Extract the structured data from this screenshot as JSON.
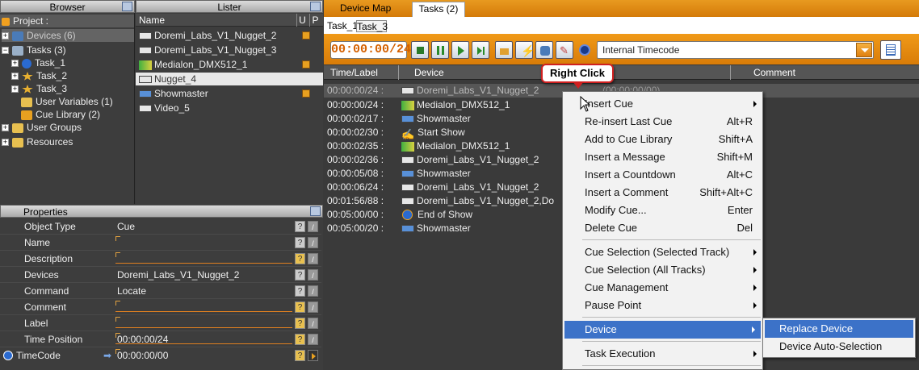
{
  "browser": {
    "header": "Browser",
    "tree": [
      {
        "label": "Project :"
      },
      {
        "label": "Devices (6)"
      },
      {
        "label": "Tasks (3)"
      },
      {
        "label": "Task_1"
      },
      {
        "label": "Task_2"
      },
      {
        "label": "Task_3"
      },
      {
        "label": "User Variables (1)"
      },
      {
        "label": "Cue Library (2)"
      },
      {
        "label": "User Groups"
      },
      {
        "label": "Resources"
      }
    ]
  },
  "lister": {
    "header": "Lister",
    "col_name": "Name",
    "col_u": "U",
    "col_p": "P",
    "items": [
      {
        "label": "Doremi_Labs_V1_Nugget_2"
      },
      {
        "label": "Doremi_Labs_V1_Nugget_3"
      },
      {
        "label": "Medialon_DMX512_1"
      },
      {
        "label": "Nugget_4"
      },
      {
        "label": "Showmaster"
      },
      {
        "label": "Video_5"
      }
    ]
  },
  "properties": {
    "header": "Properties",
    "rows": [
      {
        "label": "Object Type",
        "value": "Cue"
      },
      {
        "label": "Name",
        "value": ""
      },
      {
        "label": "Description",
        "value": ""
      },
      {
        "label": "Devices",
        "value": "Doremi_Labs_V1_Nugget_2"
      },
      {
        "label": "Command",
        "value": "Locate"
      },
      {
        "label": "Comment",
        "value": ""
      },
      {
        "label": "Label",
        "value": ""
      },
      {
        "label": "Time Position",
        "value": "00:00:00/24"
      },
      {
        "label": "TimeCode",
        "value": "00:00:00/00"
      }
    ]
  },
  "devicemap": {
    "tab_device_map": "Device Map",
    "tab_tasks": "Tasks (2)",
    "subtab_1": "Task_1",
    "subtab_3": "Task_3",
    "timecode": "00:00:00/24",
    "timecode_source": "Internal Timecode",
    "col_time": "Time/Label",
    "col_device": "Device",
    "col_comment": "Comment",
    "cues": [
      {
        "time": "00:00:00/24 :",
        "device": "Doremi_Labs_V1_Nugget_2"
      },
      {
        "time": "00:00:00/24 :",
        "device": "Medialon_DMX512_1"
      },
      {
        "time": "00:00:02/17 :",
        "device": "Showmaster"
      },
      {
        "time": "00:00:02/30 :",
        "device": "Start Show"
      },
      {
        "time": "00:00:02/35 :",
        "device": "Medialon_DMX512_1"
      },
      {
        "time": "00:00:02/36 :",
        "device": "Doremi_Labs_V1_Nugget_2"
      },
      {
        "time": "00:00:05/08 :",
        "device": "Showmaster"
      },
      {
        "time": "00:00:06/24 :",
        "device": "Doremi_Labs_V1_Nugget_2"
      },
      {
        "time": "00:01:56/88 :",
        "device": "Doremi_Labs_V1_Nugget_2,Do"
      },
      {
        "time": "00:05:00/00 :",
        "device": "End of Show"
      },
      {
        "time": "00:05:00/20 :",
        "device": "Showmaster"
      }
    ],
    "row0_extra": "(00:00:00/00)"
  },
  "callout": "Right Click",
  "context_menu": {
    "items": [
      {
        "label": "Insert Cue",
        "shortcut": ""
      },
      {
        "label": "Re-insert Last Cue",
        "shortcut": "Alt+R"
      },
      {
        "label": "Add to Cue Library",
        "shortcut": "Shift+A"
      },
      {
        "label": "Insert a Message",
        "shortcut": "Shift+M"
      },
      {
        "label": "Insert a Countdown",
        "shortcut": "Alt+C"
      },
      {
        "label": "Insert a Comment",
        "shortcut": "Shift+Alt+C"
      },
      {
        "label": "Modify Cue...",
        "shortcut": "Enter"
      },
      {
        "label": "Delete Cue",
        "shortcut": "Del"
      },
      {
        "label": "Cue Selection (Selected Track)",
        "shortcut": ""
      },
      {
        "label": "Cue Selection (All Tracks)",
        "shortcut": ""
      },
      {
        "label": "Cue Management",
        "shortcut": ""
      },
      {
        "label": "Pause Point",
        "shortcut": ""
      },
      {
        "label": "Device",
        "shortcut": ""
      },
      {
        "label": "Task Execution",
        "shortcut": ""
      }
    ]
  },
  "submenu": {
    "items": [
      {
        "label": "Replace Device"
      },
      {
        "label": "Device Auto-Selection"
      }
    ]
  }
}
